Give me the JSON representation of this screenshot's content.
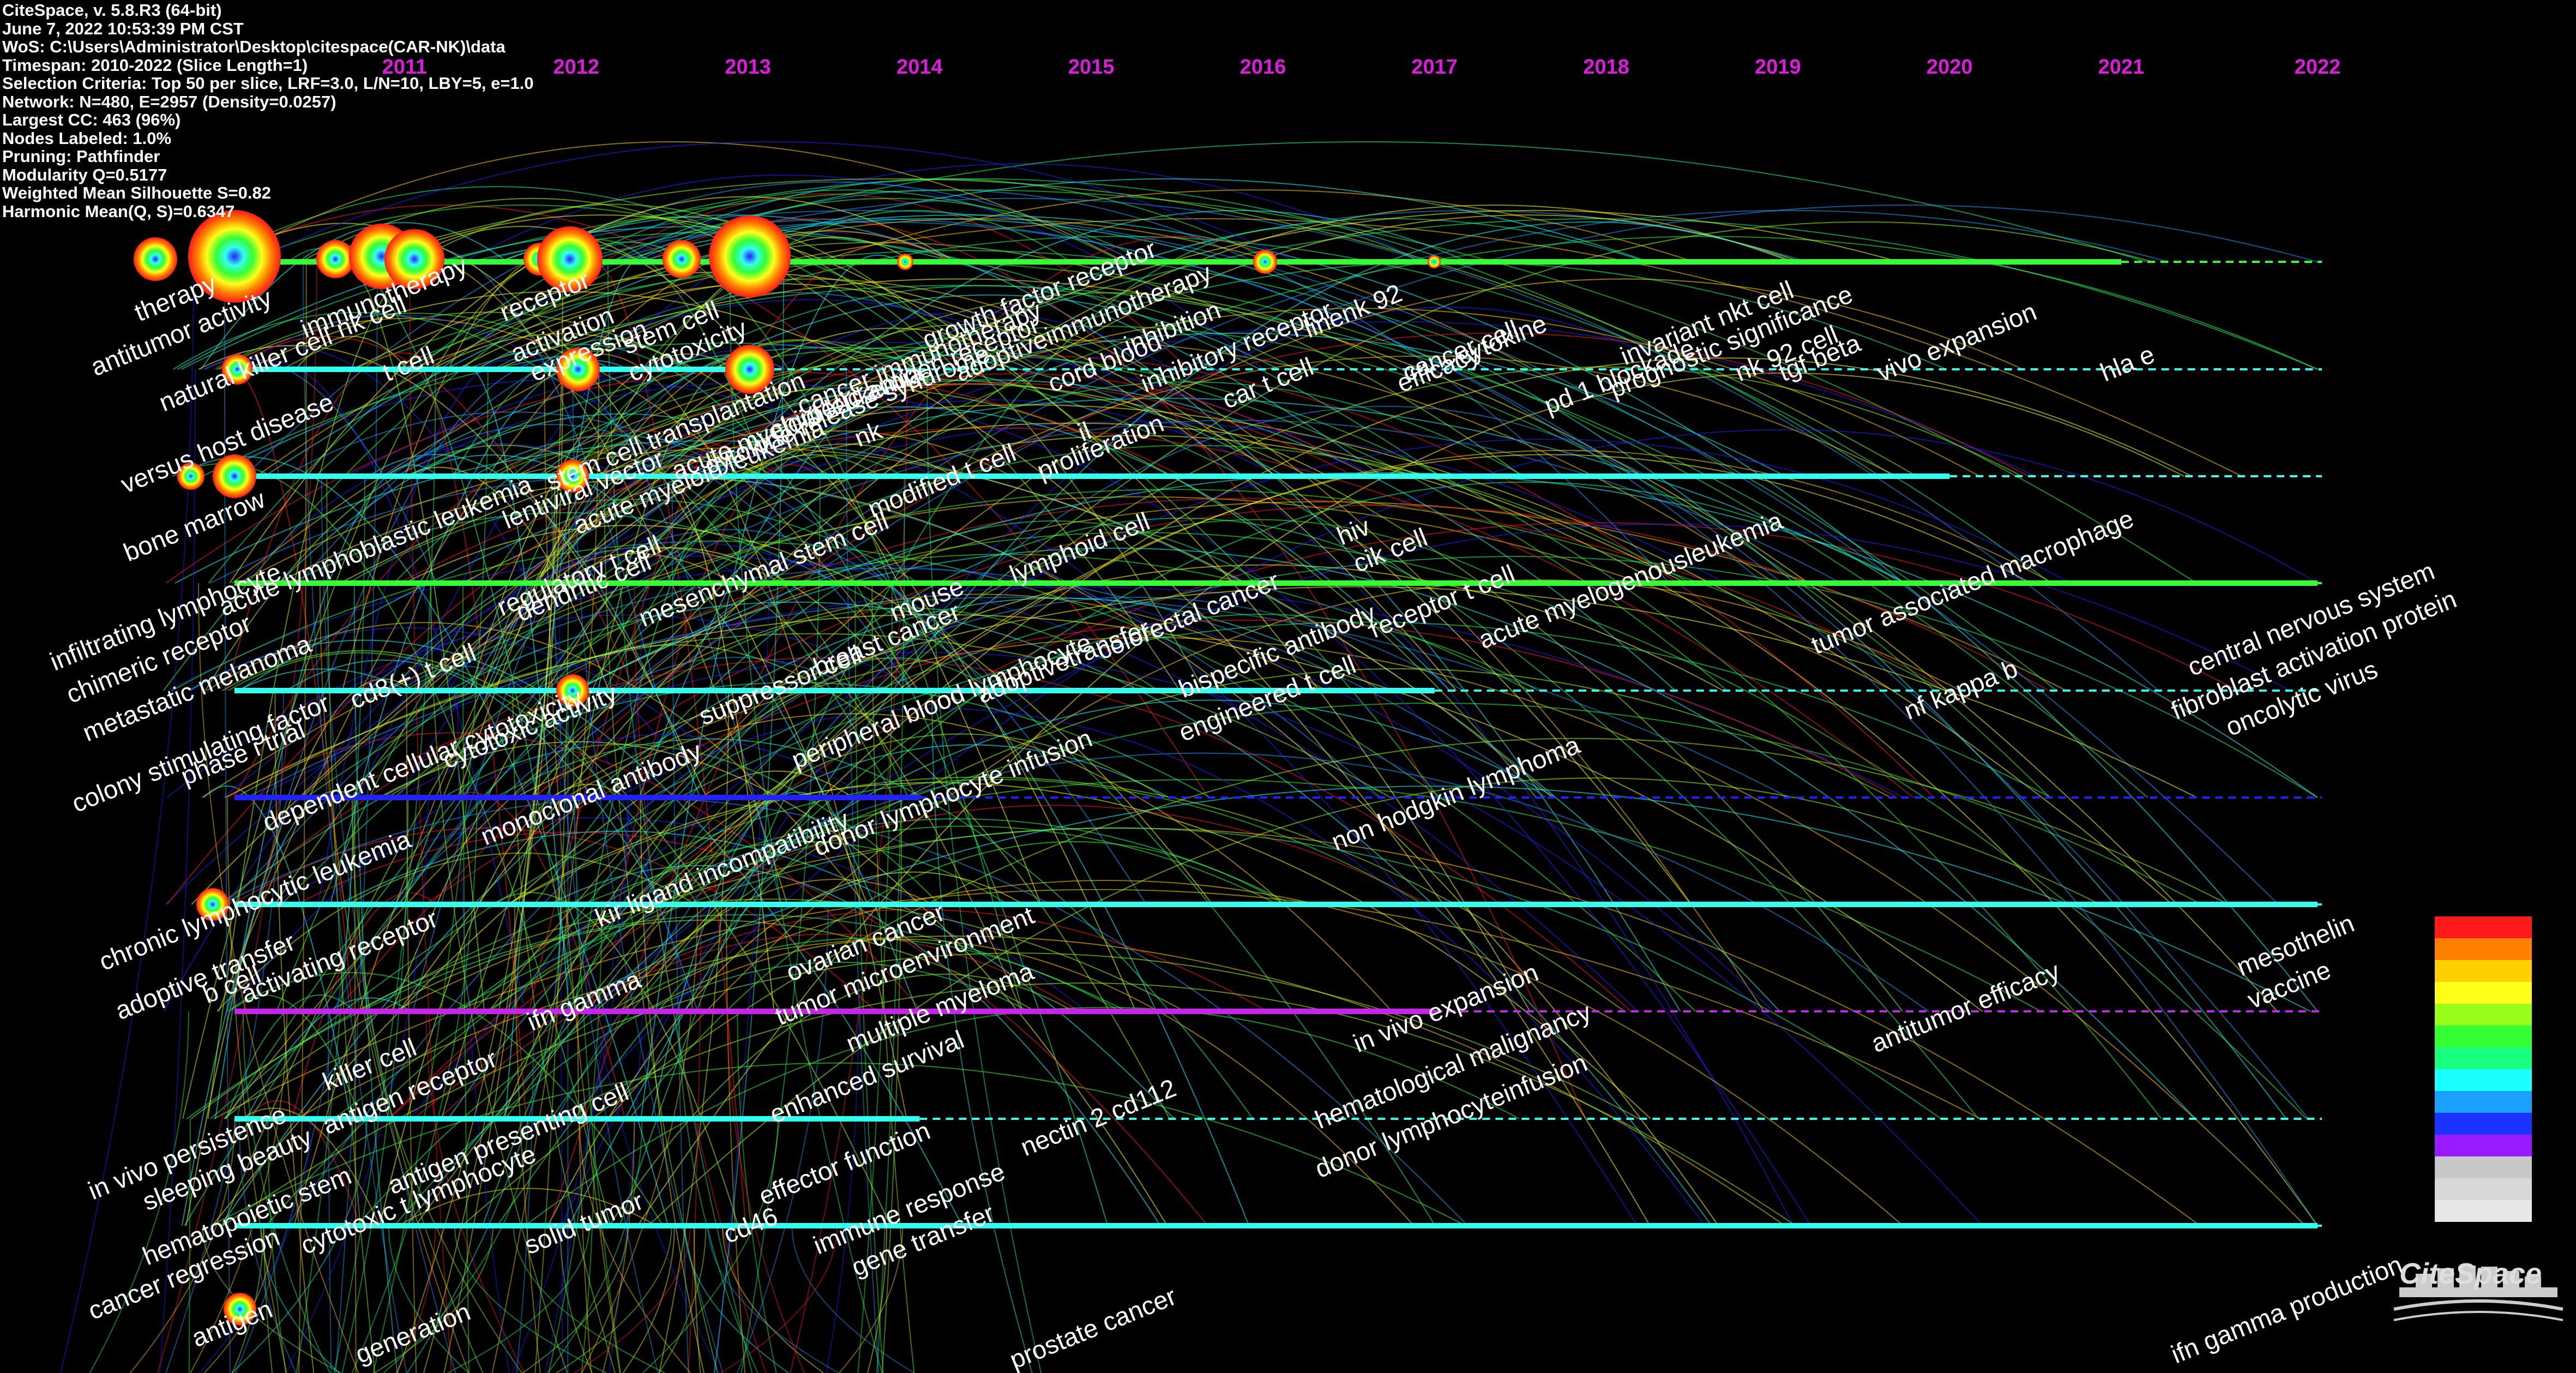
{
  "info": {
    "lines": [
      "CiteSpace, v. 5.8.R3 (64-bit)",
      "June 7, 2022 10:53:39 PM CST",
      "WoS: C:\\Users\\Administrator\\Desktop\\citespace(CAR-NK)\\data",
      "Timespan: 2010-2022 (Slice Length=1)",
      "Selection Criteria: Top 50 per slice, LRF=3.0, L/N=10, LBY=5, e=1.0",
      "Network: N=480, E=2957 (Density=0.0257)",
      "Largest CC: 463 (96%)",
      "Nodes Labeled: 1.0%",
      "Pruning: Pathfinder",
      "Modularity Q=0.5177",
      "Weighted Mean Silhouette S=0.82",
      "Harmonic Mean(Q, S)=0.6347"
    ]
  },
  "years": [
    "2011",
    "2012",
    "2013",
    "2014",
    "2015",
    "2016",
    "2017",
    "2018",
    "2019",
    "2020",
    "2021",
    "2022"
  ],
  "timelines": [
    {
      "color": "#33ff33",
      "solid_to": "2021",
      "dashed_to": "2022"
    },
    {
      "color": "#33ffee",
      "solid_to": "2013",
      "dashed_to": "2022"
    },
    {
      "color": "#33ffee",
      "solid_to": "2020",
      "dashed_to": "2022"
    },
    {
      "color": "#33ff33",
      "solid_to": "2022",
      "dashed_to": "2022"
    },
    {
      "color": "#33ffee",
      "solid_to": "2017",
      "dashed_to": "2022"
    },
    {
      "color": "#2222ff",
      "solid_to": "2014",
      "dashed_to": "2022"
    },
    {
      "color": "#33ffee",
      "solid_to": "2022",
      "dashed_to": "2022"
    },
    {
      "color": "#cc22ee",
      "solid_to": "2017",
      "dashed_to": "2022"
    },
    {
      "color": "#33ffee",
      "solid_to": "2014",
      "dashed_to": "2022"
    },
    {
      "color": "#33ffee",
      "solid_to": "2022",
      "dashed_to": "2022"
    }
  ],
  "keywords": [
    "therapy",
    "antitumor activity",
    "natural killer cell",
    "immunotherapy",
    "nk cell",
    "t cell",
    "receptor",
    "activation",
    "expression",
    "stem cell",
    "cytotoxicity",
    "chimeric antigen receptor",
    "cancer immunotherapy",
    "growth factor receptor",
    "adoptiveimmunotherapy",
    "cord blood",
    "inhibition",
    "inhibitory receptor",
    "car t cell",
    "linenk 92",
    "cancer cell",
    "efficacy",
    "cytokine",
    "invariant nkt cell",
    "pd 1 blockade",
    "prognostic significance",
    "nk 92 cell",
    "tgf beta",
    "vivo expansion",
    "hla e",
    "versus host disease",
    "bone marrow",
    "acute lymphoblastic leukemia",
    "lentiviral vector",
    "stem cell transplantation",
    "acute myeloid leukemia",
    "cytokine release syndrome",
    "nk",
    "il",
    "proliferation",
    "modified t cell",
    "infiltrating lymphocyte",
    "chimeric receptor",
    "regulatory t cell",
    "dendritic cell",
    "acute myeloid leukemia",
    "mesenchymal stem cell",
    "mouse",
    "lymphoid cell",
    "hiv",
    "cik cell",
    "metastatic melanoma",
    "cd8(+) t cell",
    "colony stimulating factor",
    "suppressor cell",
    "breast cancer",
    "peripheral blood lymphocyte",
    "adoptivetransfer",
    "colorectal cancer",
    "bispecific antibody",
    "engineered t cell",
    "receptor t cell",
    "acute myelogenousleukemia",
    "tumor associated macrophage",
    "nf kappa b",
    "central nervous system",
    "fibroblast activation protein",
    "oncolytic virus",
    "phase i trial",
    "dependent cellular cytotoxicity",
    "cytotoxic activity",
    "monoclonal antibody",
    "donor lymphocyte infusion",
    "non hodgkin lymphoma",
    "chronic lymphocytic leukemia",
    "kir ligand incompatibility",
    "adoptive transfer",
    "ovarian cancer",
    "tumor microenvironment",
    "b cell",
    "ifn gamma",
    "multiple myeloma",
    "in vivo expansion",
    "antitumor efficacy",
    "mesothelin",
    "vaccine",
    "in vivo persistence",
    "activating receptor",
    "killer cell",
    "enhanced survival",
    "hematological malignancy",
    "donor lymphocyteinfusion",
    "sleeping beauty",
    "antigen receptor",
    "effector function",
    "nectin 2 cd112",
    "hematopoietic stem",
    "antigen presenting cell",
    "cd46",
    "immune response",
    "cytotoxic t lymphocyte",
    "solid tumor",
    "gene transfer",
    "cancer regression",
    "antigen",
    "generation",
    "prostate cancer",
    "ifn gamma production"
  ],
  "legend": {
    "colors": [
      "#ff1a1a",
      "#ff8000",
      "#ffd000",
      "#ffff1a",
      "#99ff1a",
      "#33ff33",
      "#1aff80",
      "#1affff",
      "#1aa0ff",
      "#1a33ff",
      "#9a1aff",
      "#c8c8c8",
      "#d8d8d8",
      "#e8e8e8"
    ]
  },
  "logo": {
    "text": "CiteSpace"
  }
}
